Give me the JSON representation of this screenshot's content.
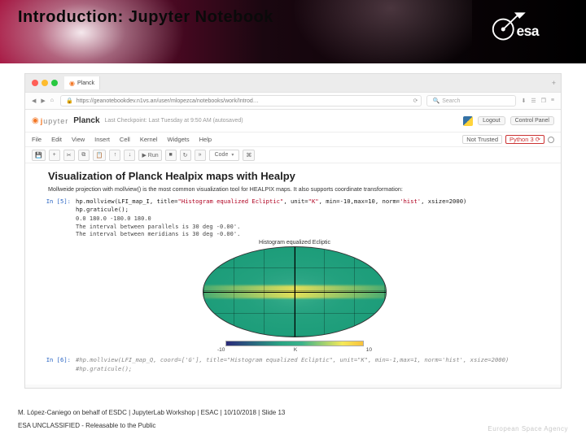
{
  "slide": {
    "title": "Introduction: Jupyter Notebook",
    "footer_credit": "M. López-Caniego on behalf of ESDC | JupyterLab Workshop | ESAC | 10/10/2018 | Slide  13",
    "footer_class": "ESA UNCLASSIFIED - Releasable to the Public",
    "ea_wordmark": "European Space Agency",
    "esa_text": "esa"
  },
  "browser": {
    "traffic": [
      "#ff5f57",
      "#febc2e",
      "#28c840"
    ],
    "tab_label": "Planck",
    "url_bar": "https://geanotebookdev.n1vs.an/user/mlopezca/notebooks/work/Introd…",
    "search_placeholder": "Search",
    "reload_glyph": "⟳",
    "lock_glyph": "🔒",
    "menu_glyph": "≡",
    "icons": {
      "back": "◀",
      "fwd": "▶",
      "home": "⌂",
      "dl": "⬇",
      "book": "☰",
      "win": "❐"
    }
  },
  "notebook": {
    "jupyter_brand": "jupyter",
    "title": "Planck",
    "checkpoint": "Last Checkpoint: Last Tuesday at 9:50 AM (autosaved)",
    "logout": "Logout",
    "control_panel": "Control Panel",
    "kernel_name": "Python 3",
    "trusted": "Not Trusted",
    "menu": [
      "File",
      "Edit",
      "View",
      "Insert",
      "Cell",
      "Kernel",
      "Widgets",
      "Help"
    ],
    "toolbar": {
      "save": "💾",
      "add": "+",
      "cut": "✂",
      "copy": "⧉",
      "paste": "📋",
      "up": "↑",
      "down": "↓",
      "run": "▶ Run",
      "stop": "■",
      "restart": "↻",
      "ff": "»",
      "celltype": "Code",
      "cmd": "⌘"
    },
    "h2": "Visualization of Planck Healpix maps with Healpy",
    "md": "Mollweide projection with mollview() is the most common visualization tool for HEALPIX maps. It also supports coordinate transformation:",
    "in_prompt": "In [5]:",
    "code": {
      "l1a": "hp.mollview(LFI_map_I, title=",
      "l1s1": "\"Histogram equalized Ecliptic\"",
      "l1b": ", unit=",
      "l1s2": "\"K\"",
      "l1c": ", min=-10,max=10, norm=",
      "l1s3": "'hist'",
      "l1d": ", xsize=2000)",
      "l2": "hp.graticule();"
    },
    "stdout": "0.0 180.0 -180.0 180.0\nThe interval between parallels is 30 deg -0.00'.\nThe interval between meridians is 30 deg -0.00'.",
    "fig_title": "Histogram equalized Ecliptic",
    "cbar_ticks": [
      "-10",
      "K",
      "10"
    ],
    "out_prompt": "In [6]:",
    "out_code": "#hp.mollview(LFI_map_Q, coord=['G'], title=\"Histogram equalized Ecliptic\", unit=\"K\", min=-1,max=1, norm='hist', xsize=2000)\n#hp.graticule();"
  }
}
